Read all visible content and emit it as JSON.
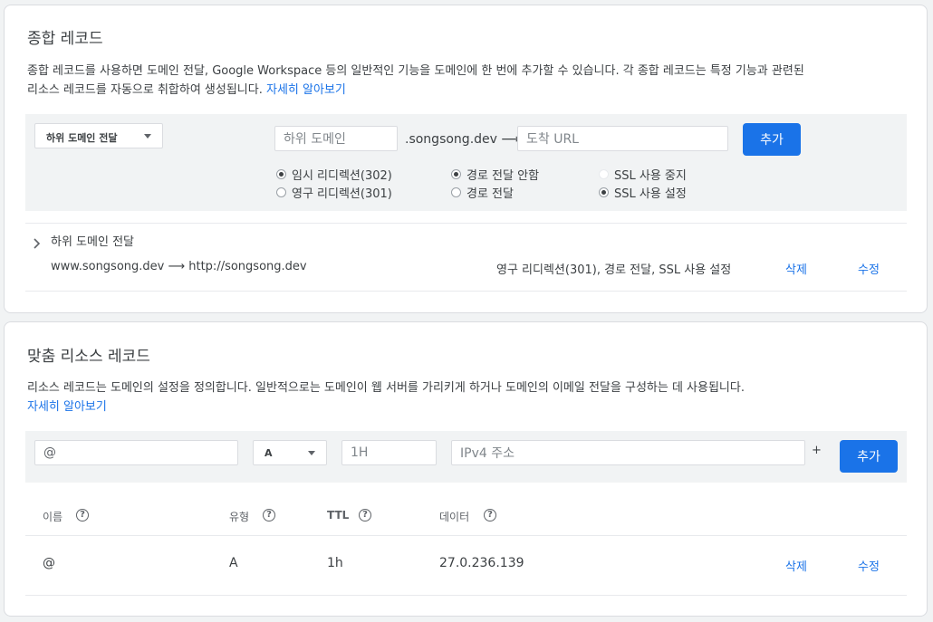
{
  "synthetic": {
    "title": "종합 레코드",
    "desc_line1": "종합 레코드를 사용하면 도메인 전달, Google Workspace 등의 일반적인 기능을 도메인에 한 번에 추가할 수 있습니다. 각 종합 레코드는 특정 기능과 관련된",
    "desc_line2": "리소스 레코드를 자동으로 취합하여 생성됩니다.",
    "learn_more": "자세히 알아보기",
    "form": {
      "type_select": "하위 도메인 전달",
      "subdomain_placeholder": "하위 도메인",
      "domain_suffix": ".songsong.dev ⟶",
      "url_placeholder": "도착 URL",
      "add_button": "추가",
      "redirect_options": [
        {
          "label": "임시 리디렉션(302)",
          "checked": true
        },
        {
          "label": "영구 리디렉션(301)",
          "checked": false
        }
      ],
      "path_options": [
        {
          "label": "경로 전달 안함",
          "checked": true
        },
        {
          "label": "경로 전달",
          "checked": false
        }
      ],
      "ssl_options": [
        {
          "label": "SSL 사용 중지",
          "checked": false
        },
        {
          "label": "SSL 사용 설정",
          "checked": true
        }
      ]
    },
    "record_group": {
      "title": "하위 도메인 전달",
      "mapping": "www.songsong.dev ⟶ http://songsong.dev",
      "details": "영구 리디렉션(301), 경로 전달, SSL 사용 설정",
      "delete_label": "삭제",
      "edit_label": "수정"
    }
  },
  "custom": {
    "title": "맞춤 리소스 레코드",
    "desc_line1": "리소스 레코드는 도메인의 설정을 정의합니다. 일반적으로는 도메인이 웹 서버를 가리키게 하거나 도메인의 이메일 전달을 구성하는 데 사용됩니다.",
    "learn_more": "자세히 알아보기",
    "form": {
      "name_value": "@",
      "type_value": "A",
      "ttl_value": "1H",
      "data_placeholder": "IPv4 주소",
      "plus": "+",
      "add_button": "추가"
    },
    "table": {
      "headers": {
        "name": "이름",
        "type": "유형",
        "ttl": "TTL",
        "data": "데이터"
      },
      "help_glyph": "?",
      "rows": [
        {
          "name": "@",
          "type": "A",
          "ttl": "1h",
          "data": "27.0.236.139",
          "delete_label": "삭제",
          "edit_label": "수정"
        }
      ]
    }
  },
  "colors": {
    "accent": "#1a73e8",
    "bar": "#f1f3f4",
    "border": "#dadce0"
  }
}
